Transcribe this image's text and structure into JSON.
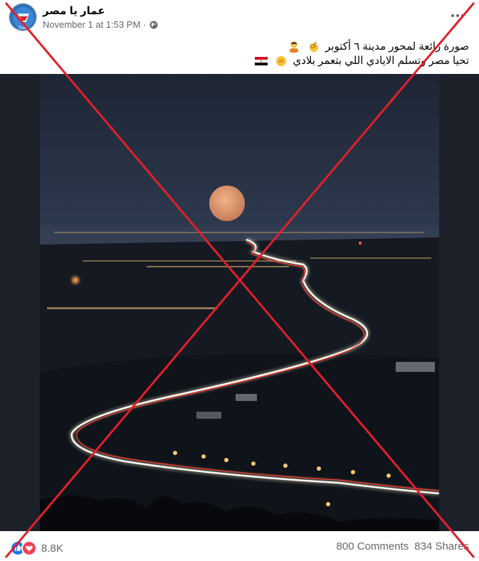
{
  "post": {
    "author": "عمار يا مصر",
    "timestamp": "November 1 at 1:53 PM",
    "audience_icon": "globe-icon",
    "more_icon": "more-icon",
    "caption_line1": "صورة رائعة لمحور مدينة ٦ أكتوبر",
    "caption_line2": "تحيا مصر وتسلم الايادي اللي بتعمر بلادي",
    "avatar_text": "Dalia"
  },
  "footer": {
    "reaction_icons": [
      "like-icon",
      "love-icon"
    ],
    "reaction_count": "8.8K",
    "comments": "800 Comments",
    "shares": "834 Shares"
  },
  "colors": {
    "cross": "#e0202a",
    "night_sky": "#2a3446",
    "road_light": "#fff6e0",
    "brake_light": "#ff3a2a"
  }
}
